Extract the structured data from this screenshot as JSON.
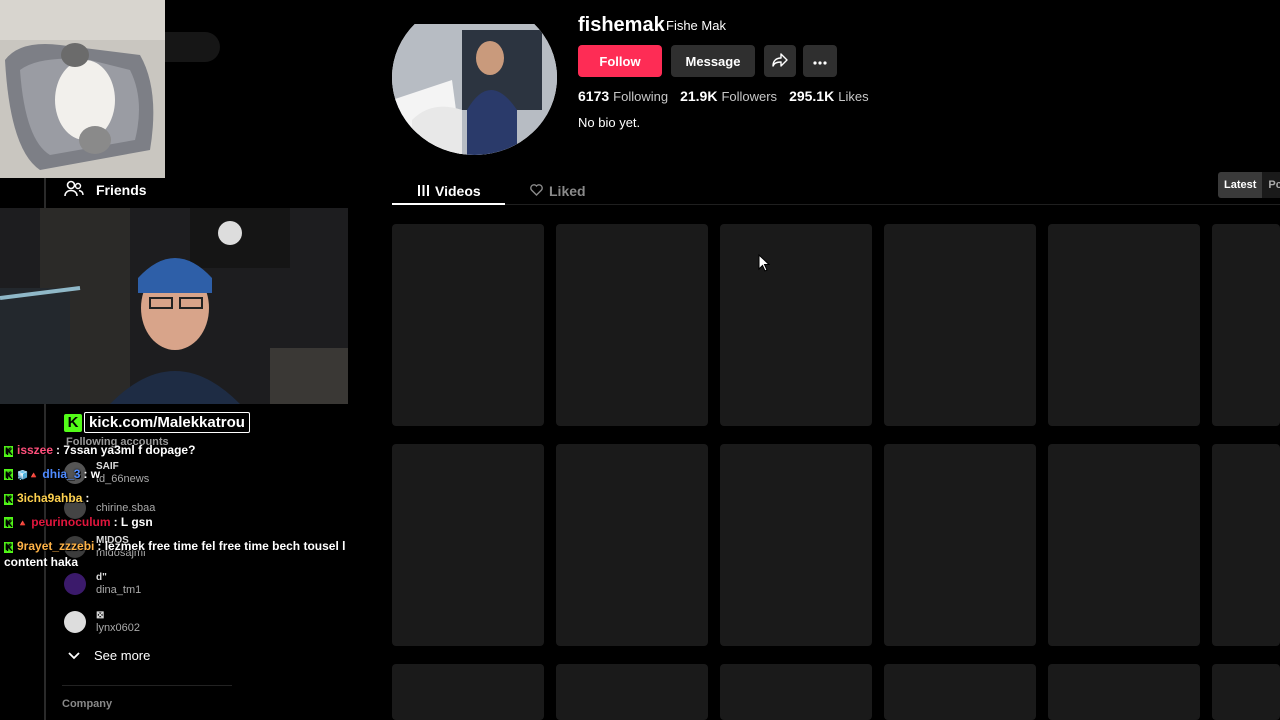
{
  "profile": {
    "username": "fishemak",
    "nickname": "Fishe Mak",
    "follow_label": "Follow",
    "message_label": "Message",
    "stats": [
      {
        "value": "6173",
        "label": "Following"
      },
      {
        "value": "21.9K",
        "label": "Followers"
      },
      {
        "value": "295.1K",
        "label": "Likes"
      }
    ],
    "bio": "No bio yet."
  },
  "tabs": {
    "videos": "Videos",
    "liked": "Liked"
  },
  "sort": {
    "latest": "Latest",
    "popular": "Pc"
  },
  "sidebar": {
    "friends_label": "Friends",
    "following_title": "Following accounts",
    "accounts": [
      {
        "nick": "SAIF",
        "handle": "td_66news"
      },
      {
        "nick": "",
        "handle": "chirine.sbaa"
      },
      {
        "nick": "MIDOS",
        "handle": "midosajmi"
      },
      {
        "nick": "d\"",
        "handle": "dina_tm1"
      },
      {
        "nick": "⊠",
        "handle": "lynx0602"
      }
    ],
    "see_more": "See more",
    "company": "Company"
  },
  "overlay": {
    "kick_url": "kick.com/Malekkatrou",
    "chat": [
      {
        "user": "isszee",
        "user_color": "#ff4f7b",
        "text": "7ssan ya3ml f dopage?",
        "badges": ""
      },
      {
        "user": "dhia_3",
        "user_color": "#4f8bff",
        "text": "w",
        "badges": "🧊🔺"
      },
      {
        "user": "3icha9ahba",
        "user_color": "#ffd24f",
        "text": "",
        "badges": ""
      },
      {
        "user": "peurinoculum",
        "user_color": "#e0163d",
        "text": "L gsn",
        "badges": "🔺"
      },
      {
        "user": "9rayet_zzzebi",
        "user_color": "#ffb347",
        "text": "lezmek free time fel free time bech tousel l content haka",
        "badges": ""
      }
    ]
  },
  "colors": {
    "accent": "#fe2c55",
    "kick_green": "#53fc18"
  }
}
